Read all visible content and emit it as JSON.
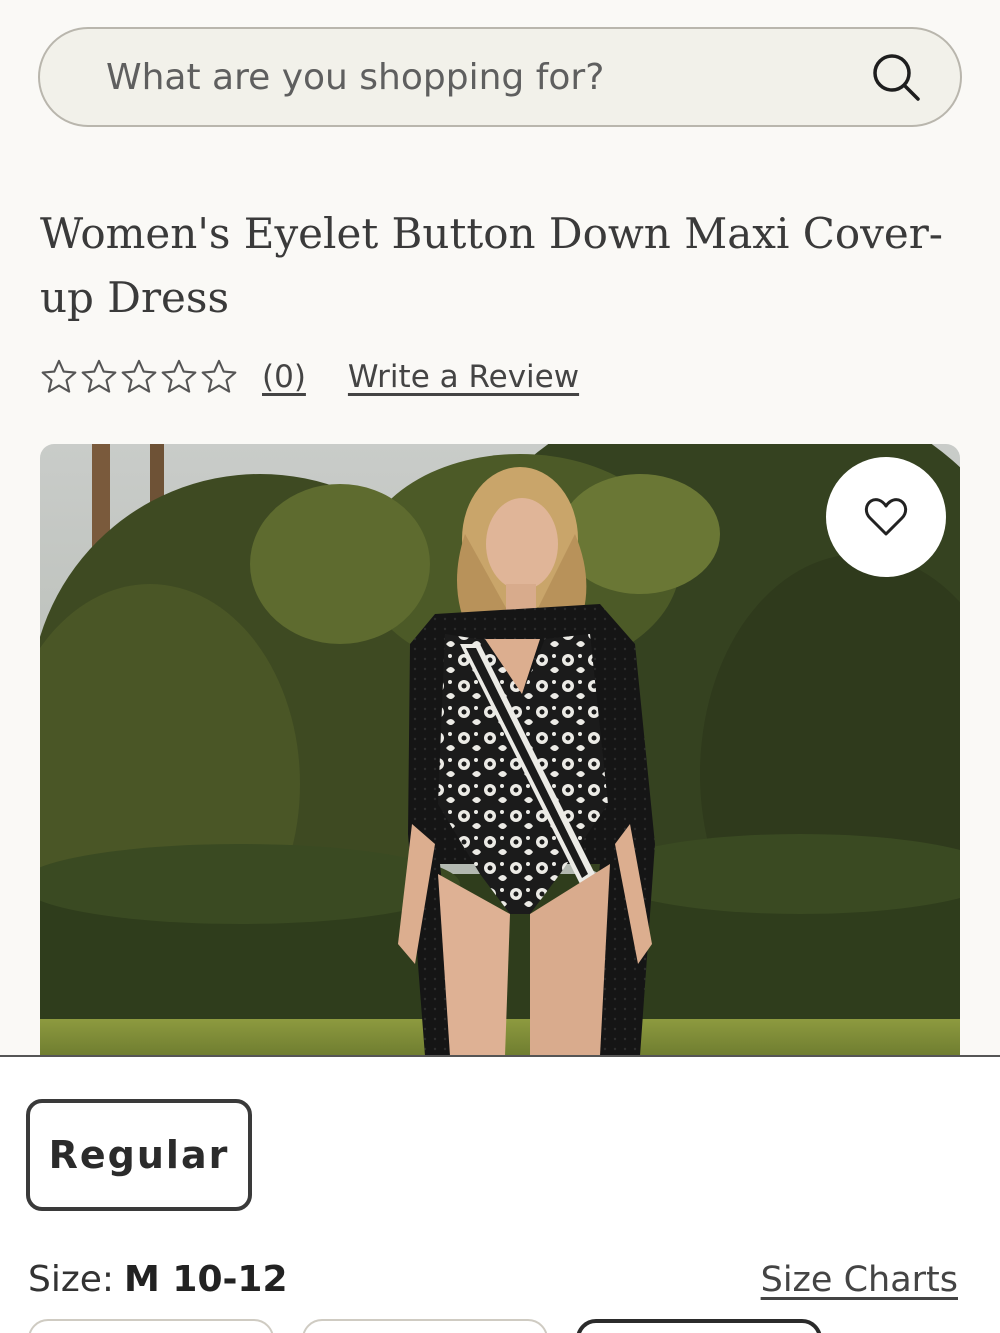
{
  "search": {
    "placeholder": "What are you shopping for?",
    "icon": "search-icon"
  },
  "product": {
    "title": "Women's Eyelet Button Down Maxi Cover-up Dress",
    "rating": {
      "stars_filled": 0,
      "stars_total": 5,
      "count_label": "(0)",
      "write_review_label": "Write a Review"
    },
    "image_alt": "Model wearing black eyelet maxi cover-up over black and white floral wrap swimsuit",
    "wishlist_icon": "heart-icon"
  },
  "options": {
    "fit_label": "Regular",
    "size_label": "Size:",
    "size_value": "M 10-12",
    "size_charts_label": "Size Charts"
  },
  "colors": {
    "background": "#faf9f6",
    "search_bg": "#f2f1ea",
    "text": "#2b2b2b"
  }
}
